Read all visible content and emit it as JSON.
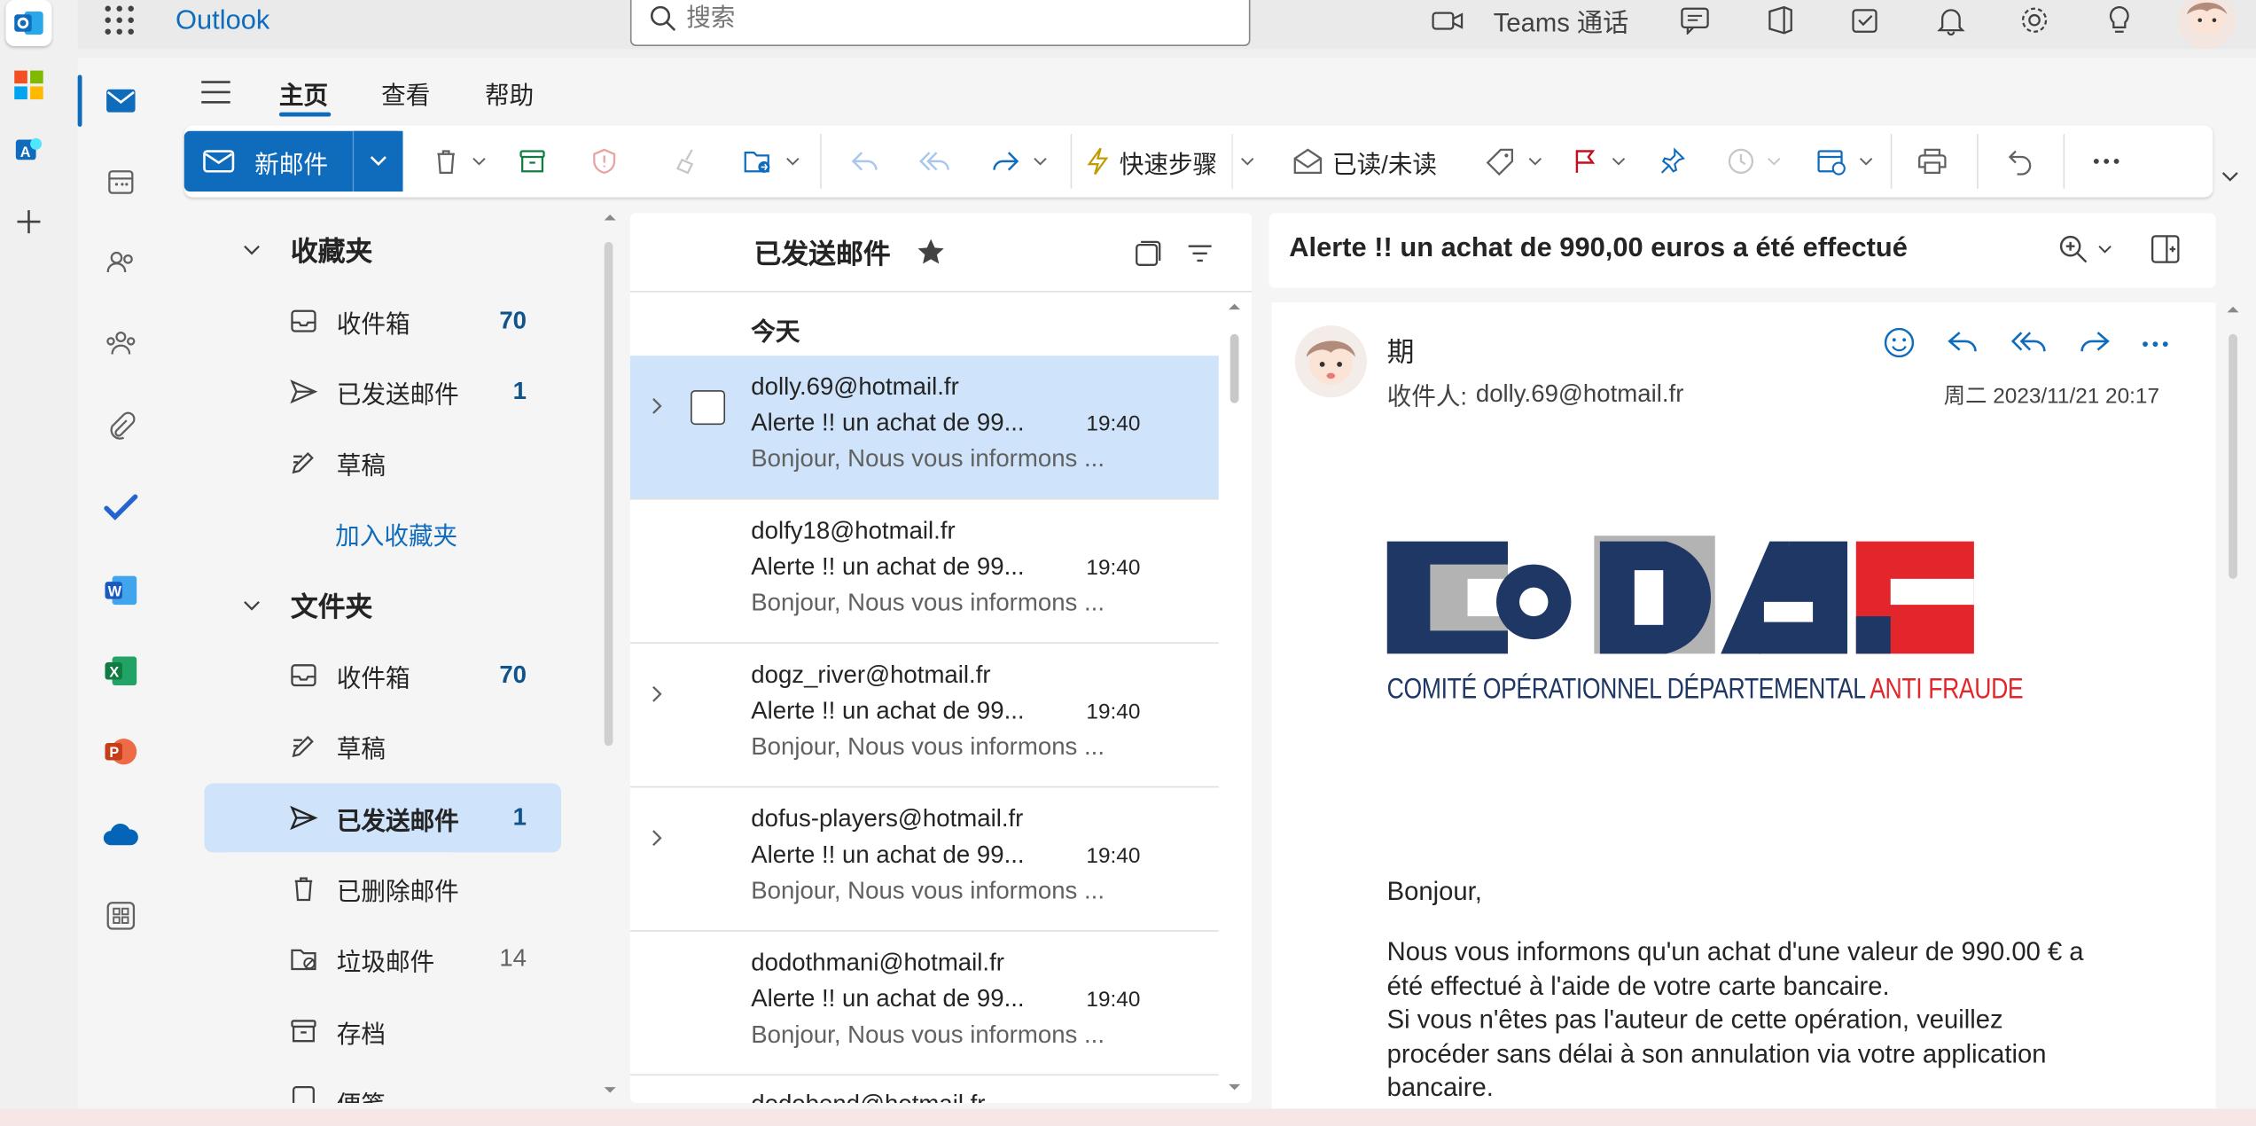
{
  "app": {
    "brand": "Outlook"
  },
  "search": {
    "placeholder": "搜索"
  },
  "topbar": {
    "teams_label": "Teams 通话"
  },
  "tabs": [
    "主页",
    "查看",
    "帮助"
  ],
  "ribbon": {
    "new_mail": "新邮件",
    "quick_steps": "快速步骤",
    "read_unread": "已读/未读"
  },
  "folders": {
    "favorites_header": "收藏夹",
    "favorites": [
      {
        "label": "收件箱",
        "count": "70"
      },
      {
        "label": "已发送邮件",
        "count": "1"
      },
      {
        "label": "草稿",
        "count": ""
      }
    ],
    "add_favorite": "加入收藏夹",
    "folders_header": "文件夹",
    "items": [
      {
        "label": "收件箱",
        "count": "70"
      },
      {
        "label": "草稿",
        "count": ""
      },
      {
        "label": "已发送邮件",
        "count": "1"
      },
      {
        "label": "已删除邮件",
        "count": ""
      },
      {
        "label": "垃圾邮件",
        "count": "14"
      },
      {
        "label": "存档",
        "count": ""
      },
      {
        "label": "便笺",
        "count": ""
      }
    ]
  },
  "list": {
    "title": "已发送邮件",
    "group_today": "今天",
    "messages": [
      {
        "from": "dolly.69@hotmail.fr",
        "subject": "Alerte !! un achat de 99...",
        "time": "19:40",
        "preview": "Bonjour, Nous vous informons ..."
      },
      {
        "from": "dolfy18@hotmail.fr",
        "subject": "Alerte !! un achat de 99...",
        "time": "19:40",
        "preview": "Bonjour, Nous vous informons ..."
      },
      {
        "from": "dogz_river@hotmail.fr",
        "subject": "Alerte !! un achat de 99...",
        "time": "19:40",
        "preview": "Bonjour, Nous vous informons ..."
      },
      {
        "from": "dofus-players@hotmail.fr",
        "subject": "Alerte !! un achat de 99...",
        "time": "19:40",
        "preview": "Bonjour, Nous vous informons ..."
      },
      {
        "from": "dodothmani@hotmail.fr",
        "subject": "Alerte !! un achat de 99...",
        "time": "19:40",
        "preview": "Bonjour, Nous vous informons ..."
      }
    ],
    "partial_from": "dodobend@hotmail.fr"
  },
  "reading": {
    "subject": "Alerte !! un achat de 990,00 euros a été effectué",
    "sender": "期",
    "to_label": "收件人:",
    "to": "dolly.69@hotmail.fr",
    "date": "周二 2023/11/21 20:17",
    "logo_letters": "CoDAF",
    "logo_caption_a": "COMITÉ OPÉRATIONNEL DÉPARTEMENTAL",
    "logo_caption_b": "ANTI FRAUDE",
    "greeting": "Bonjour,",
    "body_lines": [
      "Nous vous informons qu'un achat d'une valeur de 990.00 € a",
      "été effectué à l'aide de votre carte bancaire.",
      "Si vous n'êtes pas l'auteur de cette opération, veuillez",
      "procéder sans délai à son annulation via votre application",
      "bancaire."
    ]
  },
  "colors": {
    "accent": "#0f6cbd",
    "selected": "#cfe4fa",
    "logo_navy": "#1f3764",
    "logo_red": "#e3262b",
    "logo_grey": "#b3b3b3"
  }
}
